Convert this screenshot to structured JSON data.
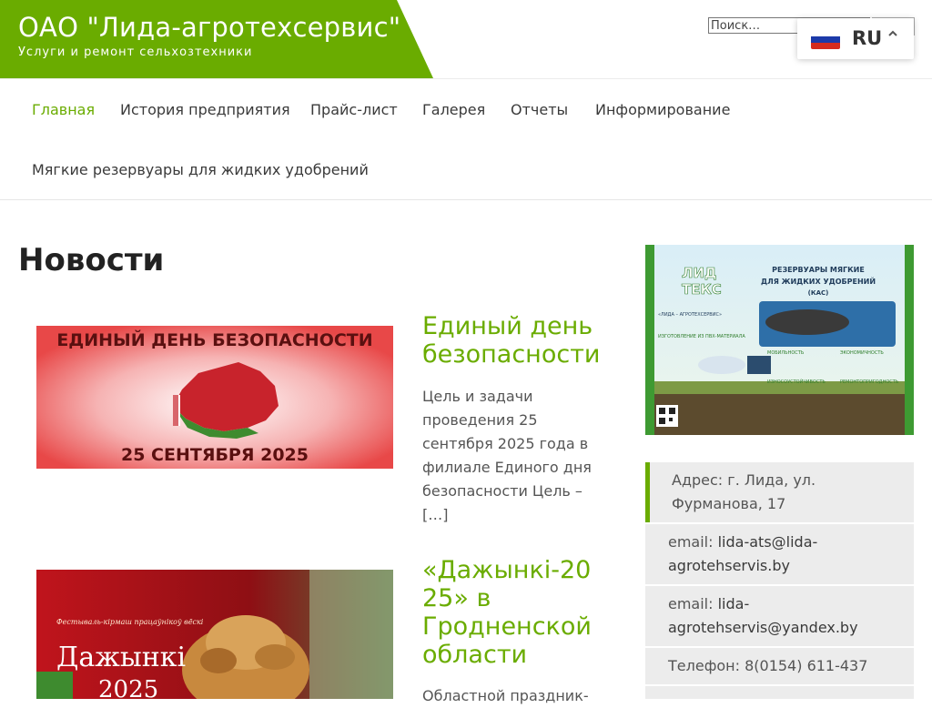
{
  "header": {
    "site_title": "ОАО \"Лида-агротехсервис\"",
    "tagline": "Услуги и ремонт сельхозтехники",
    "search_placeholder": "Поиск…",
    "language": "RU",
    "brand_color": "#6aac00"
  },
  "nav": {
    "items": [
      {
        "label": "Главная",
        "active": true
      },
      {
        "label": "История предприятия",
        "active": false
      },
      {
        "label": "Прайс-лист",
        "active": false
      },
      {
        "label": "Галерея",
        "active": false
      },
      {
        "label": "Отчеты",
        "active": false
      },
      {
        "label": "Информирование",
        "active": false
      },
      {
        "label": "Мягкие резервуары для жидких удобрений",
        "active": false
      }
    ]
  },
  "main": {
    "page_title": "Новости",
    "posts": [
      {
        "title_lines": [
          "Единый день",
          "безопасности"
        ],
        "excerpt_lines": [
          "Цель и задачи",
          "проведения 25",
          "сентября 2025 года в",
          "филиале Единого дня",
          "безопасности Цель –",
          "[…]"
        ],
        "image_text_top": "ЕДИНЫЙ ДЕНЬ БЕЗОПАСНОСТИ",
        "image_text_bottom": "25 СЕНТЯБРЯ 2025"
      },
      {
        "title_lines": [
          "«Дажынкі-20",
          "25» в",
          "Гродненской",
          "области"
        ],
        "excerpt_lines": [
          "Областной праздник-"
        ],
        "image_text_small": "Фестываль-кірмаш працаўнікоў вёскі",
        "image_text_big": "Дажынкі",
        "image_text_year": "2025"
      }
    ]
  },
  "sidebar": {
    "banner": {
      "logo_line1": "ЛИД",
      "logo_line2": "ТЕКС",
      "heading_line1": "РЕЗЕРВУАРЫ МЯГКИЕ",
      "heading_line2": "ДЛЯ ЖИДКИХ УДОБРЕНИЙ",
      "heading_line3": "(КАС)",
      "org": "«ЛИДА – АГРОТЕХСЕРВИС»",
      "features": [
        "МОБИЛЬНОСТЬ",
        "ЭКОНОМИЧНОСТЬ",
        "ИЗНОСОУСТОЙЧИВОСТЬ",
        "РЕМОНТОПРИГОДНОСТЬ"
      ],
      "left_heading": "ИЗГОТОВЛЕНИЕ ИЗ ПВХ-МАТЕРИАЛА"
    },
    "contacts": [
      {
        "label": "Адрес: г. Лида, ул. Фурманова, 17",
        "value": ""
      },
      {
        "label": "email: ",
        "value": "lida-ats@lida-agrotehservis.by"
      },
      {
        "label": "email: ",
        "value": "lida-agrotehservis@yandex.by"
      },
      {
        "label": "Телефон: 8(0154) 611-437",
        "value": ""
      }
    ]
  }
}
